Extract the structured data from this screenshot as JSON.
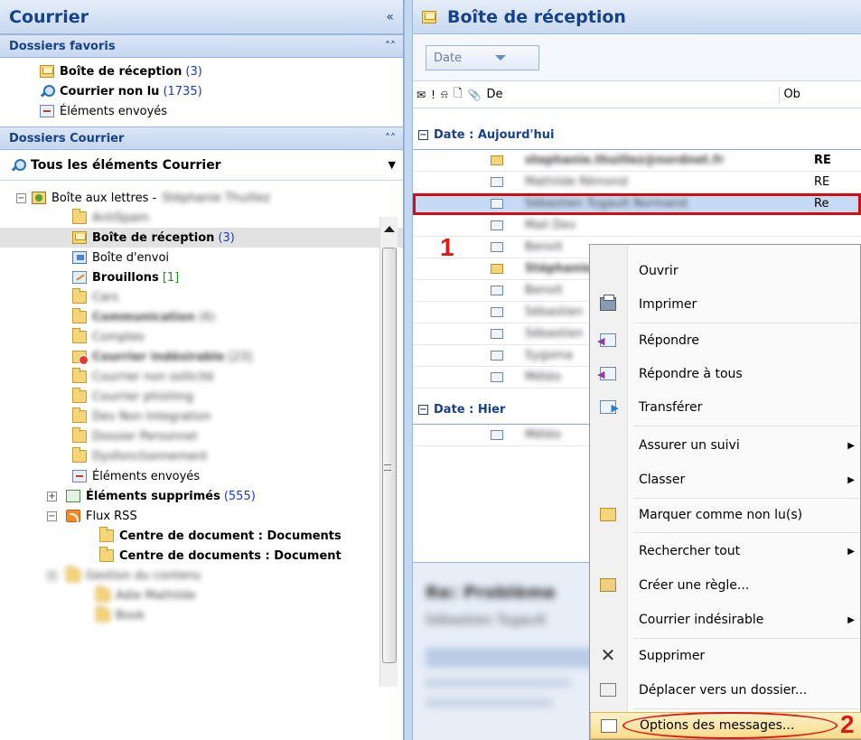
{
  "left_pane": {
    "title": "Courrier",
    "collapse_glyph": "«",
    "favorites_title": "Dossiers favoris",
    "favorites": [
      {
        "label": "Boîte de réception",
        "count": "(3)",
        "icon": "inbox-icon"
      },
      {
        "label": "Courrier non lu",
        "count": "(1735)",
        "icon": "search-folder-icon"
      },
      {
        "label": "Éléments envoyés",
        "count": "",
        "icon": "sent-items-icon"
      }
    ],
    "mail_folders_title": "Dossiers Courrier",
    "all_items_label": "Tous les éléments Courrier",
    "mailbox_label": "Boîte aux lettres -",
    "mailbox_owner": "Stéphanie Thuillez",
    "folders": [
      {
        "label": "AntiSpam",
        "count": "",
        "blurred": true,
        "bold": false
      },
      {
        "label": "Boîte de réception",
        "count": "(3)",
        "blurred": false,
        "bold": true
      },
      {
        "label": "Boîte d'envoi",
        "count": "",
        "blurred": false,
        "bold": false
      },
      {
        "label": "Brouillons",
        "count": "[1]",
        "blurred": false,
        "bold": true
      },
      {
        "label": "Cars",
        "count": "",
        "blurred": true,
        "bold": false
      },
      {
        "label": "Communication",
        "count": "(6)",
        "blurred": true,
        "bold": true
      },
      {
        "label": "Comptes",
        "count": "",
        "blurred": true,
        "bold": false
      },
      {
        "label": "Courrier indésirable",
        "count": "[23]",
        "blurred": true,
        "bold": true
      },
      {
        "label": "Courrier non sollicité",
        "count": "",
        "blurred": true,
        "bold": false
      },
      {
        "label": "Courrier phishing",
        "count": "",
        "blurred": true,
        "bold": false
      },
      {
        "label": "Dev Non Integration",
        "count": "",
        "blurred": true,
        "bold": false
      },
      {
        "label": "Dossier Personnel",
        "count": "",
        "blurred": true,
        "bold": false
      },
      {
        "label": "Dysfonctionnement",
        "count": "",
        "blurred": true,
        "bold": false
      },
      {
        "label": "Éléments envoyés",
        "count": "",
        "blurred": false,
        "bold": false
      },
      {
        "label": "Éléments supprimés",
        "count": "(555)",
        "blurred": false,
        "bold": true
      },
      {
        "label": "Flux RSS",
        "count": "",
        "blurred": false,
        "bold": false
      },
      {
        "label": "Centre de document : Documents",
        "count": "",
        "blurred": false,
        "bold": true
      },
      {
        "label": "Centre de documents : Document",
        "count": "",
        "blurred": false,
        "bold": true
      },
      {
        "label": "Gestion du contenu",
        "count": "",
        "blurred": true,
        "bold": false
      },
      {
        "label": "Adie Mathilde",
        "count": "",
        "blurred": true,
        "bold": false
      },
      {
        "label": "Book",
        "count": "",
        "blurred": true,
        "bold": false
      }
    ]
  },
  "right_pane": {
    "title": "Boîte de réception",
    "arrange_by": "Date",
    "from_header": "De",
    "subject_header": "Ob",
    "group_today": "Date : Aujourd'hui",
    "group_yesterday": "Date : Hier",
    "messages": [
      {
        "from": "stephanie.thuillez@nordnet.fr",
        "subject": "RE",
        "subject_bold": true,
        "unread": true
      },
      {
        "from": "Mathilde Rémond",
        "subject": "RE",
        "subject_bold": false,
        "unread": false
      },
      {
        "from": "Sébastien Tugault Normand",
        "subject": "Re",
        "subject_bold": false,
        "unread": false
      },
      {
        "from": "Mail Dev",
        "subject": "",
        "subject_bold": false,
        "unread": false
      },
      {
        "from": "Benoit",
        "subject": "",
        "subject_bold": false,
        "unread": false
      },
      {
        "from": "Stéphanie",
        "subject": "",
        "subject_bold": false,
        "unread": true
      },
      {
        "from": "Benoit",
        "subject": "",
        "subject_bold": false,
        "unread": false
      },
      {
        "from": "Sébastien",
        "subject": "",
        "subject_bold": false,
        "unread": false
      },
      {
        "from": "Sébastien",
        "subject": "",
        "subject_bold": false,
        "unread": false
      },
      {
        "from": "Sygoma",
        "subject": "",
        "subject_bold": false,
        "unread": false
      },
      {
        "from": "Météo",
        "subject": "",
        "subject_bold": false,
        "unread": false
      }
    ],
    "yesterday_first_from": "Météo",
    "preview_subject": "Re: Problème",
    "preview_from": "Sébastien Tugault"
  },
  "context_menu": {
    "items": [
      {
        "label": "Ouvrir",
        "icon": "",
        "submenu": false
      },
      {
        "label": "Imprimer",
        "icon": "printer-icon",
        "submenu": false
      },
      {
        "label": "Répondre",
        "icon": "reply-icon",
        "submenu": false
      },
      {
        "label": "Répondre à tous",
        "icon": "reply-all-icon",
        "submenu": false
      },
      {
        "label": "Transférer",
        "icon": "forward-icon",
        "submenu": false
      },
      {
        "label": "Assurer un suivi",
        "icon": "",
        "submenu": true
      },
      {
        "label": "Classer",
        "icon": "",
        "submenu": true
      },
      {
        "label": "Marquer comme non lu(s)",
        "icon": "mark-unread-icon",
        "submenu": false
      },
      {
        "label": "Rechercher tout",
        "icon": "",
        "submenu": true
      },
      {
        "label": "Créer une règle...",
        "icon": "create-rule-icon",
        "submenu": false
      },
      {
        "label": "Courrier indésirable",
        "icon": "",
        "submenu": true
      },
      {
        "label": "Supprimer",
        "icon": "delete-icon",
        "submenu": false
      },
      {
        "label": "Déplacer vers un dossier...",
        "icon": "move-icon",
        "submenu": false
      },
      {
        "label": "Options des messages...",
        "icon": "message-options-icon",
        "submenu": false
      }
    ]
  },
  "annotations": {
    "step1": "1",
    "step2": "2",
    "color": "#e01818"
  }
}
